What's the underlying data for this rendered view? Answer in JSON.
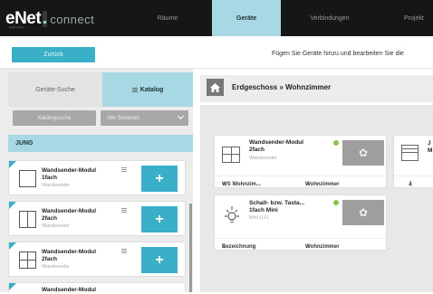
{
  "app": {
    "logo_main": "eNet",
    "logo_sub": "connect",
    "logo_tag": "smart home"
  },
  "nav": {
    "tabs": [
      {
        "label": "Räume",
        "active": false
      },
      {
        "label": "Geräte",
        "active": true
      },
      {
        "label": "Verbindungen",
        "active": false
      },
      {
        "label": "Projekt",
        "active": false
      }
    ]
  },
  "toolbar": {
    "back_label": "Zurück",
    "hint": "Fügen Sie Geräte hinzu und bearbeiten Sie die"
  },
  "left_panel": {
    "tabs": [
      {
        "label": "Geräte-Suche",
        "active": false
      },
      {
        "label": "Katalog",
        "active": true,
        "icon": "list-icon"
      }
    ],
    "filters": {
      "catalog_button": "Katalogsuche",
      "series_select": "Alle Serienen"
    },
    "manufacturer": "JUNG",
    "catalog_items": [
      {
        "title_line1": "Wandsender-Modul",
        "title_line2": "1fach",
        "type": "Wandsender",
        "add_label": "+"
      },
      {
        "title_line1": "Wandsender-Modul",
        "title_line2": "2fach",
        "type": "Wandsender",
        "add_label": "+"
      },
      {
        "title_line1": "Wandsender-Modul",
        "title_line2": "2fach",
        "type": "Wandsender",
        "add_label": "+"
      },
      {
        "title_line1": "Wandsender-Modul",
        "title_line2": "",
        "type": "",
        "add_label": ""
      }
    ]
  },
  "breadcrumb": {
    "text": "Erdgeschoss » Wohnzimmer"
  },
  "devices": [
    {
      "title_line1": "Wandsender-Modul",
      "title_line2": "2fach",
      "type": "Wandsender",
      "status_color": "#8bc34a",
      "label": "WS Wohnzim...",
      "room": "Wohnzimmer"
    },
    {
      "title_line1": "Schalt- bzw. Tasta...",
      "title_line2": "1fach Mini",
      "type": "Mini (LF)",
      "status_color": "#8bc34a",
      "label": "Bezeichnung",
      "room": "Wohnzimmer"
    },
    {
      "title_line1": "J",
      "title_line2": "M",
      "type": "",
      "status_color": "",
      "label": "J",
      "room": ""
    }
  ],
  "colors": {
    "accent": "#3ab0c8",
    "active_tab": "#a8d8e4",
    "topbar": "#161616",
    "status_ok": "#8bc34a"
  }
}
